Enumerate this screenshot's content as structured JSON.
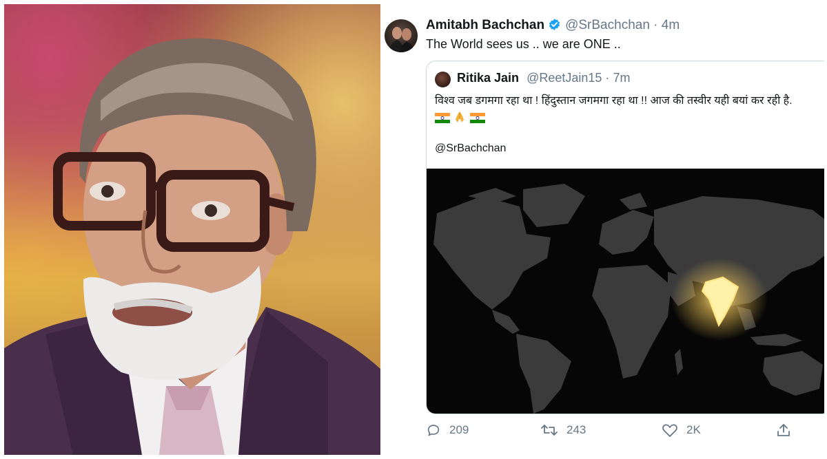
{
  "tweet": {
    "author_name": "Amitabh Bachchan",
    "author_handle": "@SrBachchan",
    "separator": "·",
    "time": "4m",
    "text": "The World sees us .. we are ONE ..",
    "verified_icon": "verified-badge-icon",
    "quoted": {
      "author_name": "Ritika Jain",
      "author_handle": "@ReetJain15",
      "separator": "·",
      "time": "7m",
      "text": "विश्व जब डगमगा रहा था ! हिंदुस्तान जगमगा रहा था !! आज की तस्वीर यही बयां कर रही है.",
      "emojis": [
        "india-flag-icon",
        "folded-hands-icon",
        "india-flag-icon"
      ],
      "mention": "@SrBachchan"
    },
    "actions": {
      "reply_count": "209",
      "retweet_count": "243",
      "like_count": "2K"
    }
  },
  "colors": {
    "accent": "#1da1f2",
    "muted": "#657786",
    "text": "#14171a",
    "border": "#ccd6dd",
    "map_land": "#3b3b3b",
    "map_highlight": "#f3c85a"
  }
}
